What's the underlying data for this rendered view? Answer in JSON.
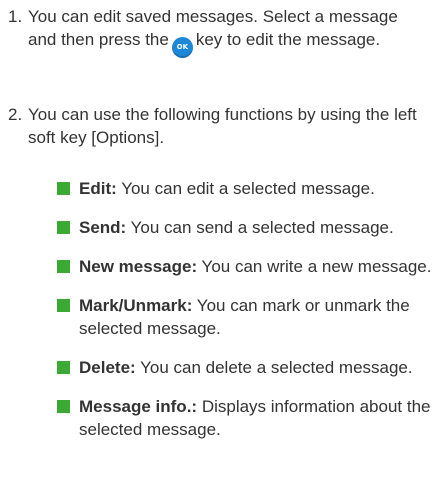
{
  "steps": [
    {
      "number": "1.",
      "text_before": "You can edit saved messages. Select a message and then press the",
      "key_label": "OK",
      "text_after": "key to edit the message."
    },
    {
      "number": "2.",
      "text": "You can use the following functions by using the left soft key [Options]."
    }
  ],
  "functions": [
    {
      "term": "Edit:",
      "desc": " You can edit a selected message."
    },
    {
      "term": "Send:",
      "desc": " You can send a selected message."
    },
    {
      "term": "New message:",
      "desc": " You can write a new message."
    },
    {
      "term": "Mark/Unmark:",
      "desc": " You can mark or unmark the selected message."
    },
    {
      "term": "Delete:",
      "desc": " You can delete a selected message."
    },
    {
      "term": "Message info.:",
      "desc": " Displays information about the selected message."
    }
  ],
  "colors": {
    "bullet": "#3aaa35",
    "ok_key": "#1e88d8",
    "text": "#333333"
  }
}
